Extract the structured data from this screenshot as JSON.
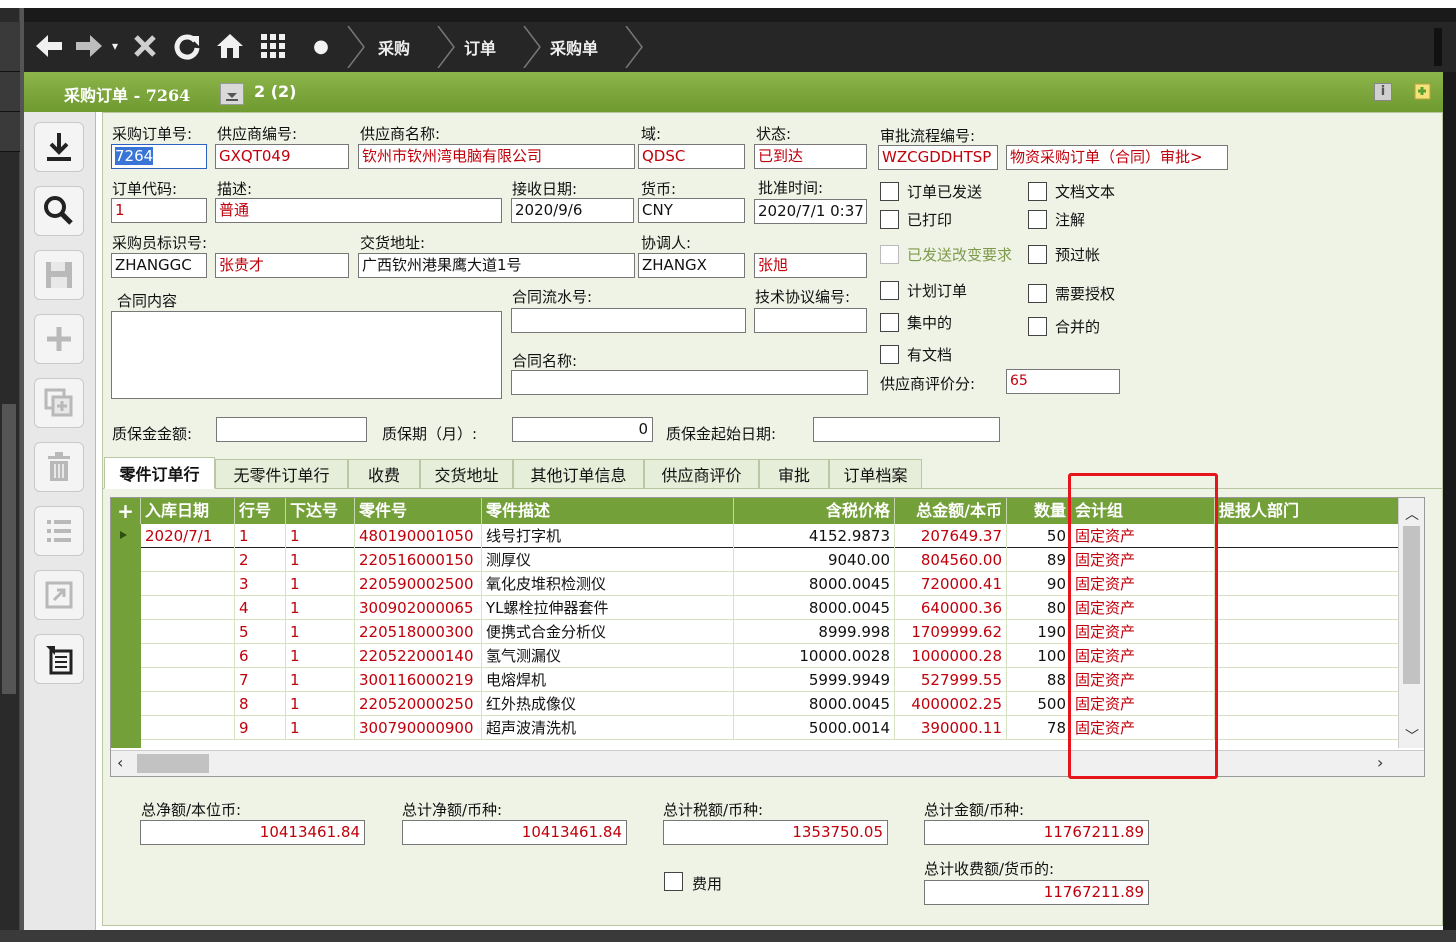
{
  "nav": {
    "crumbs": [
      "采购",
      "订单",
      "采购单"
    ]
  },
  "titlebar": {
    "title": "采购订单 - 7264",
    "count": "2 (2)"
  },
  "header": {
    "po_number_label": "采购订单号:",
    "po_number": "7264",
    "supplier_code_label": "供应商编号:",
    "supplier_code": "GXQT049",
    "supplier_name_label": "供应商名称:",
    "supplier_name": "钦州市钦州湾电脑有限公司",
    "domain_label": "域:",
    "domain": "QDSC",
    "status_label": "状态:",
    "status": "已到达",
    "approval_flow_label": "审批流程编号:",
    "approval_flow_code": "WZCGDDHTSP",
    "approval_flow_name": "物资采购订单（合同）审批>",
    "order_code_label": "订单代码:",
    "order_code": "1",
    "description_label": "描述:",
    "description": "普通",
    "receive_date_label": "接收日期:",
    "receive_date": "2020/9/6",
    "currency_label": "货币:",
    "currency": "CNY",
    "approve_time_label": "批准时间:",
    "approve_time": "2020/7/1 0:37",
    "buyer_id_label": "采购员标识号:",
    "buyer_id": "ZHANGGC",
    "buyer_name": "张贵才",
    "delivery_addr_label": "交货地址:",
    "delivery_addr": "广西钦州港果鹰大道1号",
    "coordinator_label": "协调人:",
    "coordinator_id": "ZHANGX",
    "coordinator_name": "张旭",
    "contract_content_label": "合同内容",
    "contract_serial_label": "合同流水号:",
    "tech_agreement_label": "技术协议编号:",
    "contract_name_label": "合同名称:",
    "supplier_score_label": "供应商评价分:",
    "supplier_score": "65",
    "warranty_amount_label": "质保金金额:",
    "warranty_period_label": "质保期（月）:",
    "warranty_period": "0",
    "warranty_start_label": "质保金起始日期:"
  },
  "checkboxes": {
    "order_sent": "订单已发送",
    "doc_text": "文档文本",
    "printed": "已打印",
    "annotate": "注解",
    "change_req_sent": "已发送改变要求",
    "pre_posting": "预过帐",
    "planned_order": "计划订单",
    "needs_auth": "需要授权",
    "centralized": "集中的",
    "merged": "合并的",
    "has_doc": "有文档",
    "expense": "费用"
  },
  "tabs": [
    "零件订单行",
    "无零件订单行",
    "收费",
    "交货地址",
    "其他订单信息",
    "供应商评价",
    "审批",
    "订单档案"
  ],
  "grid": {
    "add": "+",
    "columns": [
      "入库日期",
      "行号",
      "下达号",
      "零件号",
      "零件描述",
      "含税价格",
      "总金额/本币",
      "数量",
      "会计组",
      "提报人部门"
    ],
    "rows": [
      [
        "2020/7/1",
        "1",
        "1",
        "480190001050",
        "线号打字机",
        "4152.9873",
        "207649.37",
        "50",
        "固定资产"
      ],
      [
        "",
        "2",
        "1",
        "220516000150",
        "测厚仪",
        "9040.00",
        "804560.00",
        "89",
        "固定资产"
      ],
      [
        "",
        "3",
        "1",
        "220590002500",
        "氧化皮堆积检测仪",
        "8000.0045",
        "720000.41",
        "90",
        "固定资产"
      ],
      [
        "",
        "4",
        "1",
        "300902000065",
        "YL螺栓拉伸器套件",
        "8000.0045",
        "640000.36",
        "80",
        "固定资产"
      ],
      [
        "",
        "5",
        "1",
        "220518000300",
        "便携式合金分析仪",
        "8999.998",
        "1709999.62",
        "190",
        "固定资产"
      ],
      [
        "",
        "6",
        "1",
        "220522000140",
        "氢气测漏仪",
        "10000.0028",
        "1000000.28",
        "100",
        "固定资产"
      ],
      [
        "",
        "7",
        "1",
        "300116000219",
        "电熔焊机",
        "5999.9949",
        "527999.55",
        "88",
        "固定资产"
      ],
      [
        "",
        "8",
        "1",
        "220520000250",
        "红外热成像仪",
        "8000.0045",
        "4000002.25",
        "500",
        "固定资产"
      ],
      [
        "",
        "9",
        "1",
        "300790000900",
        "超声波清洗机",
        "5000.0014",
        "390000.11",
        "78",
        "固定资产"
      ]
    ]
  },
  "totals": {
    "net_local_label": "总净额/本位币:",
    "net_local": "10413461.84",
    "net_currency_label": "总计净额/币种:",
    "net_currency": "10413461.84",
    "tax_label": "总计税额/币种:",
    "tax": "1353750.05",
    "total_label": "总计金额/币种:",
    "total": "11767211.89",
    "fee_label": "总计收费额/货币的:",
    "fee": "11767211.89"
  },
  "colors": {
    "accent": "#74a03a",
    "red_text": "#c0000a",
    "highlight": "#e8141b"
  }
}
